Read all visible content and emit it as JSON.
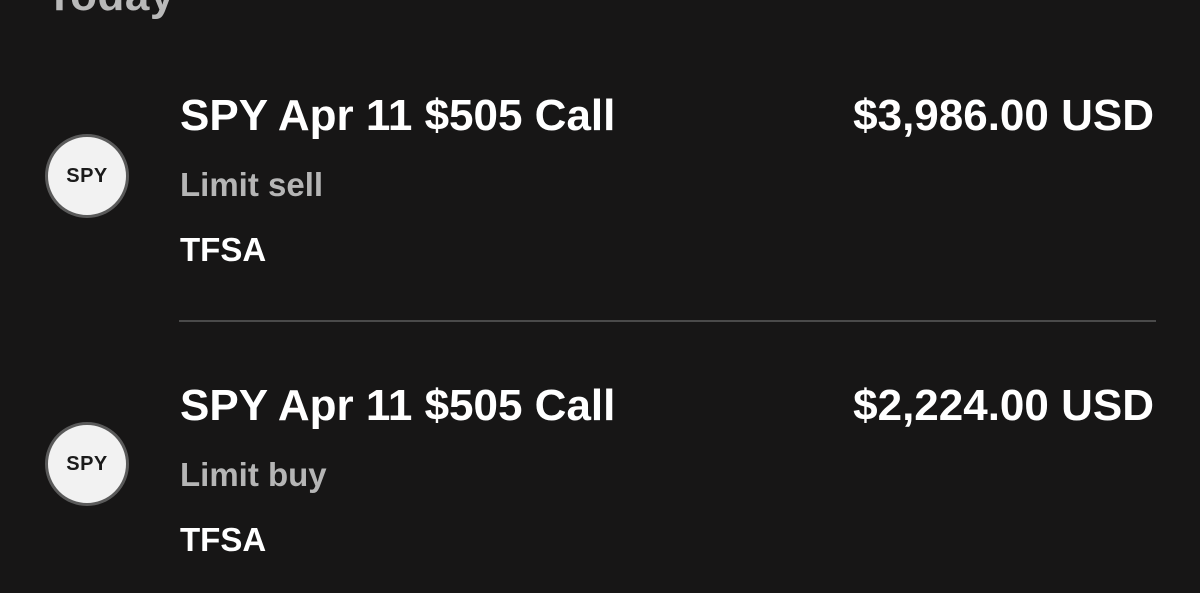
{
  "section": {
    "title": "Today"
  },
  "activity": [
    {
      "symbol": "SPY",
      "contract": "SPY Apr 11 $505 Call",
      "amount": "$3,986.00 USD",
      "order_type": "Limit sell",
      "account": "TFSA"
    },
    {
      "symbol": "SPY",
      "contract": "SPY Apr 11 $505 Call",
      "amount": "$2,224.00 USD",
      "order_type": "Limit buy",
      "account": "TFSA"
    }
  ]
}
